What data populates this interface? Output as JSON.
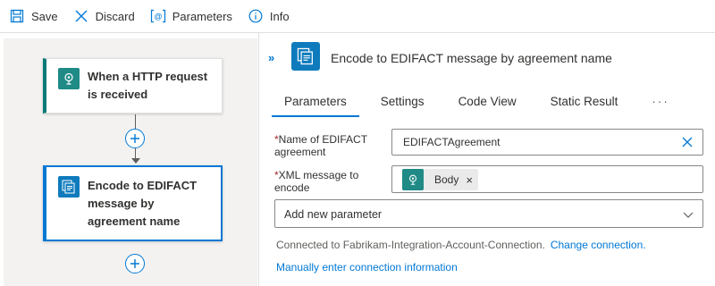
{
  "toolbar": {
    "save_label": "Save",
    "discard_label": "Discard",
    "parameters_label": "Parameters",
    "info_label": "Info"
  },
  "canvas": {
    "trigger_title": "When a HTTP request is received",
    "action_title": "Encode to EDIFACT message by agreement name"
  },
  "panel": {
    "title": "Encode to EDIFACT message by agreement name",
    "tabs": [
      {
        "label": "Parameters",
        "active": true
      },
      {
        "label": "Settings",
        "active": false
      },
      {
        "label": "Code View",
        "active": false
      },
      {
        "label": "Static Result",
        "active": false
      }
    ],
    "tabs_more": "···",
    "fields": {
      "agreement_label": "Name of EDIFACT agreement",
      "agreement_value": "EDIFACTAgreement",
      "xml_label": "XML message to encode",
      "xml_token": "Body",
      "required_mark": "*"
    },
    "add_parameter": "Add new parameter",
    "connection_text": "Connected to Fabrikam-Integration-Account-Connection.",
    "change_connection": "Change connection.",
    "manual_link": "Manually enter connection information"
  },
  "colors": {
    "accent": "#0078d4",
    "trigger_tile": "#1f8a86",
    "action_tile": "#0f7bbd",
    "required": "#a4262c"
  }
}
